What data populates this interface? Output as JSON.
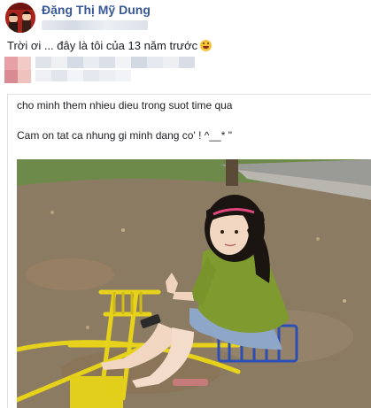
{
  "post": {
    "author_name": "Đặng Thị Mỹ Dung",
    "status_text": "Trời ơi ... đây là tôi của 13 năm trước"
  },
  "shared_post": {
    "line1": "cho minh them nhieu dieu trong suot time qua",
    "line2": "Cam on tat ca nhung gi minh dang co' ! ^__* \""
  },
  "icons": {
    "status_emoji": "grinning-face-emoji",
    "avatar": "profile-avatar"
  },
  "colors": {
    "author_link": "#385898",
    "text": "#1c1e21",
    "card_border": "#dddfe2"
  }
}
